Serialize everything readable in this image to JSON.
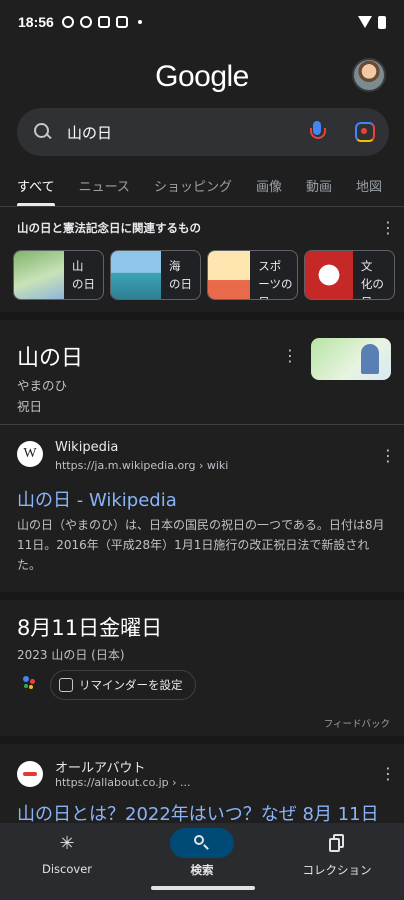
{
  "status_bar": {
    "time": "18:56"
  },
  "header": {
    "logo": "Google"
  },
  "search": {
    "query": "山の日"
  },
  "tabs": [
    "すべて",
    "ニュース",
    "ショッピング",
    "画像",
    "動画",
    "地図"
  ],
  "related": {
    "title": "山の日と憲法記念日に関連するもの",
    "chips": [
      {
        "line1": "山",
        "line2": "の日"
      },
      {
        "line1": "海",
        "line2": "の日"
      },
      {
        "line1": "スポ",
        "line2": "ーツの日"
      },
      {
        "line1": "文",
        "line2": "化の日"
      }
    ]
  },
  "knowledge_panel": {
    "title": "山の日",
    "reading": "やまのひ",
    "type": "祝日"
  },
  "result_wikipedia": {
    "site": "Wikipedia",
    "url": "https://ja.m.wikipedia.org › wiki",
    "title": "山の日 - Wikipedia",
    "snippet": "山の日（やまのひ）は、日本の国民の祝日の一つである。日付は8月11日。2016年（平成28年）1月1日施行の改正祝日法で新設された。"
  },
  "date_card": {
    "title": "8月11日金曜日",
    "subtitle": "2023 山の日 (日本)",
    "reminder_label": "リマインダーを設定",
    "feedback": "フィードバック"
  },
  "result_allabout": {
    "site": "オールアバウト",
    "url": "https://allabout.co.jp › ...",
    "title": "山の日とは？2022年はいつ？なぜ 8月 11日"
  },
  "bottom_nav": {
    "discover": "Discover",
    "search": "検索",
    "collections": "コレクション"
  },
  "colors": {
    "link": "#8ab4f8",
    "background": "#1f1f1f",
    "active_nav": "#004a77"
  }
}
